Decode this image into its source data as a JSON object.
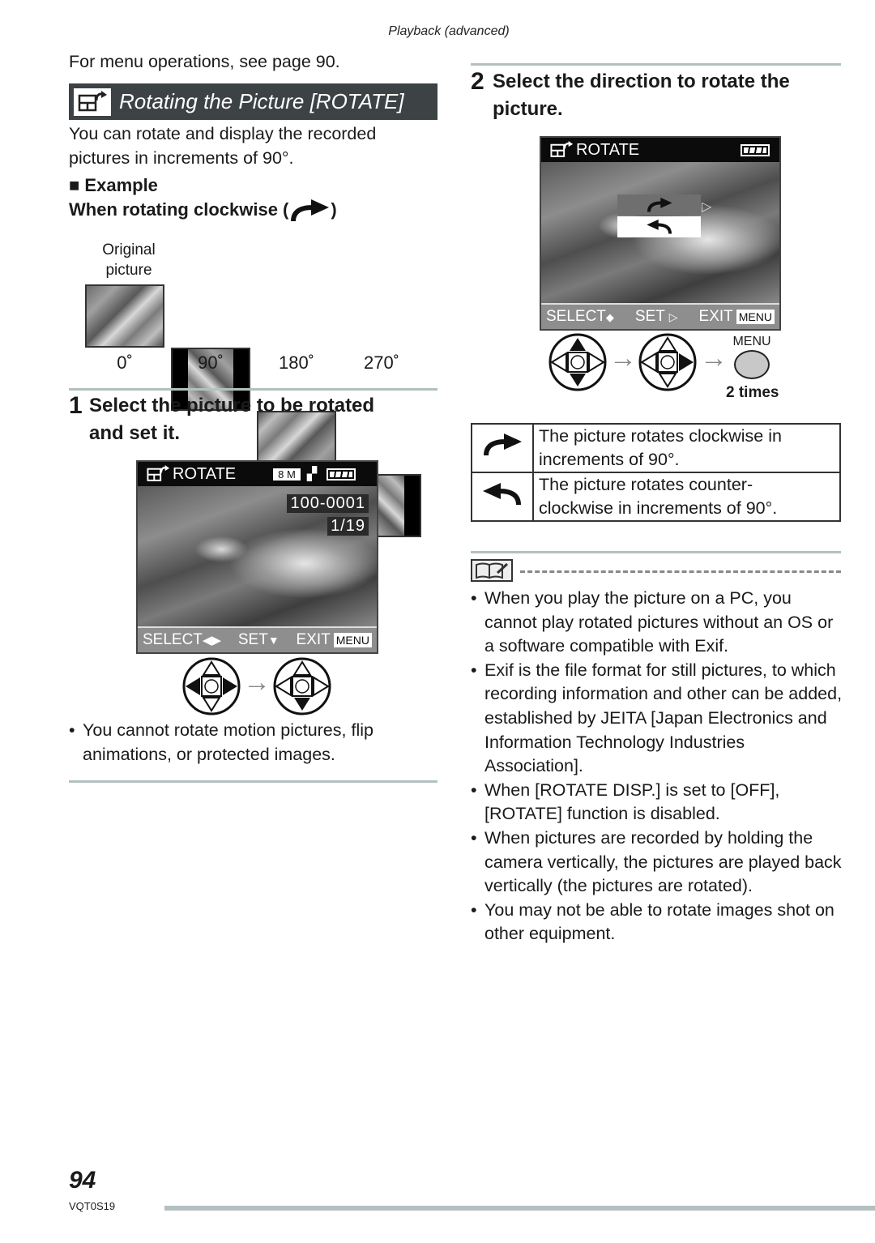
{
  "header": {
    "running_head": "Playback (advanced)"
  },
  "intro": {
    "menu_ref": "For menu operations, see page 90."
  },
  "section": {
    "title": "Rotating the Picture [ROTATE]",
    "icon": "rotate-mode-icon",
    "description": "You can rotate and display the recorded pictures in increments of 90°."
  },
  "example": {
    "heading_marker": "■",
    "heading": "Example",
    "subheading_prefix": "When rotating clockwise (",
    "subheading_suffix": ")",
    "original_label_line1": "Original",
    "original_label_line2": "picture",
    "angles": [
      "0˚",
      "90˚",
      "180˚",
      "270˚"
    ]
  },
  "step1": {
    "number": "1",
    "text_line1": "Select the picture to be rotated",
    "text_line2": "and set it.",
    "lcd": {
      "mode_label": "ROTATE",
      "resolution": "8 M",
      "file_number": "100-0001",
      "frame_count": "1/19",
      "select_label": "SELECT",
      "set_label": "SET",
      "exit_label": "EXIT",
      "menu_chip": "MENU"
    },
    "note": "You cannot rotate motion pictures, flip animations, or protected images."
  },
  "step2": {
    "number": "2",
    "text_line1": "Select the direction to rotate the",
    "text_line2": "picture.",
    "lcd": {
      "mode_label": "ROTATE",
      "options": [
        "clockwise",
        "counter-clockwise"
      ],
      "selected_option": "clockwise",
      "select_label": "SELECT",
      "set_label": "SET",
      "exit_label": "EXIT",
      "menu_chip": "MENU"
    },
    "menu_button_label": "MENU",
    "menu_press_count": "2 times"
  },
  "direction_table": [
    {
      "icon": "rotate-clockwise-icon",
      "description_line1": "The picture rotates clockwise in",
      "description_line2": "increments of 90°."
    },
    {
      "icon": "rotate-counterclockwise-icon",
      "description_line1": "The picture rotates counter-",
      "description_line2": "clockwise in increments of 90°."
    }
  ],
  "notes": [
    "When you play the picture on a PC, you cannot play rotated pictures without an OS or a software compatible with Exif.",
    "Exif is the file format for still pictures, to which recording information and other can be added, established by JEITA [Japan Electronics and Information Technology Industries Association].",
    "When [ROTATE DISP.] is set to [OFF], [ROTATE] function is disabled.",
    "When pictures are recorded by holding the camera vertically, the pictures are played back vertically (the pictures are rotated).",
    "You may not be able to rotate images shot on other equipment."
  ],
  "footer": {
    "page_number": "94",
    "model_code": "VQT0S19"
  },
  "colors": {
    "title_bar": "#3d4244",
    "rule": "#b4c0c0",
    "lcd_bottom": "#8e8e8e"
  }
}
